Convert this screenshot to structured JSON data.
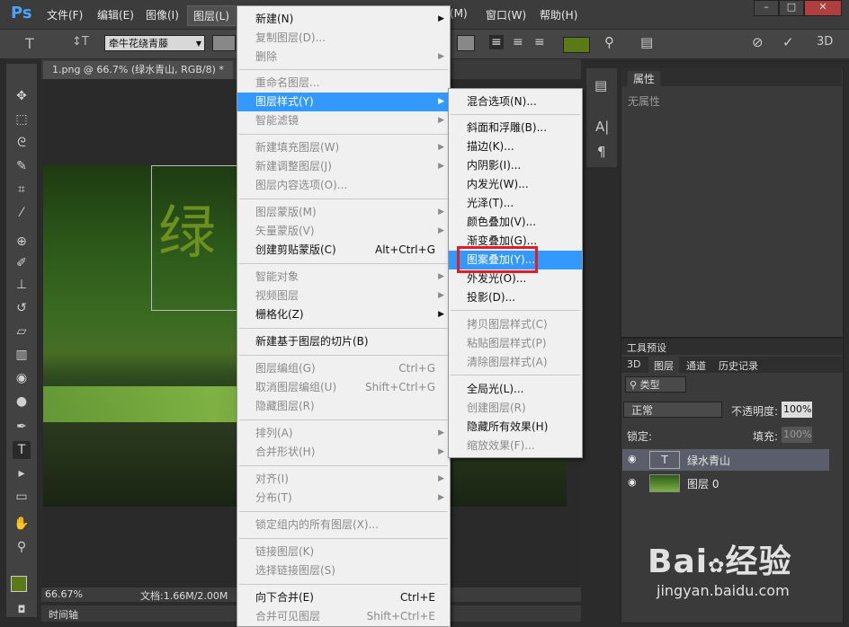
{
  "menubar": {
    "logo": "Ps",
    "items": [
      "文件(F)",
      "编辑(E)",
      "图像(I)",
      "图层(L)",
      "(M)",
      "窗口(W)",
      "帮助(H)"
    ]
  },
  "options": {
    "font_name": "牵牛花绕青藤"
  },
  "document": {
    "tab_title": "1.png @ 66.7% (绿水青山, RGB/8) *",
    "canvas_text": "绿",
    "zoom": "66.67%",
    "doc_size": "文档:1.66M/2.00M",
    "timeline": "时间轴"
  },
  "layer_menu": {
    "items": [
      {
        "label": "新建(N)",
        "shortcut": "",
        "arrow": true,
        "disabled": false
      },
      {
        "label": "复制图层(D)...",
        "shortcut": "",
        "arrow": false,
        "disabled": true
      },
      {
        "label": "删除",
        "shortcut": "",
        "arrow": true,
        "disabled": true
      },
      {
        "label": "重命名图层...",
        "shortcut": "",
        "arrow": false,
        "disabled": true
      },
      {
        "label": "图层样式(Y)",
        "shortcut": "",
        "arrow": true,
        "disabled": false,
        "highlight": true
      },
      {
        "label": "智能滤镜",
        "shortcut": "",
        "arrow": true,
        "disabled": true
      },
      {
        "label": "新建填充图层(W)",
        "shortcut": "",
        "arrow": true,
        "disabled": true
      },
      {
        "label": "新建调整图层(J)",
        "shortcut": "",
        "arrow": true,
        "disabled": true
      },
      {
        "label": "图层内容选项(O)...",
        "shortcut": "",
        "arrow": false,
        "disabled": true
      },
      {
        "label": "图层蒙版(M)",
        "shortcut": "",
        "arrow": true,
        "disabled": true
      },
      {
        "label": "矢量蒙版(V)",
        "shortcut": "",
        "arrow": true,
        "disabled": true
      },
      {
        "label": "创建剪贴蒙版(C)",
        "shortcut": "Alt+Ctrl+G",
        "arrow": false,
        "disabled": false
      },
      {
        "label": "智能对象",
        "shortcut": "",
        "arrow": true,
        "disabled": true
      },
      {
        "label": "视频图层",
        "shortcut": "",
        "arrow": true,
        "disabled": true
      },
      {
        "label": "栅格化(Z)",
        "shortcut": "",
        "arrow": true,
        "disabled": false
      },
      {
        "label": "新建基于图层的切片(B)",
        "shortcut": "",
        "arrow": false,
        "disabled": false
      },
      {
        "label": "图层编组(G)",
        "shortcut": "Ctrl+G",
        "arrow": false,
        "disabled": true
      },
      {
        "label": "取消图层编组(U)",
        "shortcut": "Shift+Ctrl+G",
        "arrow": false,
        "disabled": true
      },
      {
        "label": "隐藏图层(R)",
        "shortcut": "",
        "arrow": false,
        "disabled": true
      },
      {
        "label": "排列(A)",
        "shortcut": "",
        "arrow": true,
        "disabled": true
      },
      {
        "label": "合并形状(H)",
        "shortcut": "",
        "arrow": true,
        "disabled": true
      },
      {
        "label": "对齐(I)",
        "shortcut": "",
        "arrow": true,
        "disabled": true
      },
      {
        "label": "分布(T)",
        "shortcut": "",
        "arrow": true,
        "disabled": true
      },
      {
        "label": "锁定组内的所有图层(X)...",
        "shortcut": "",
        "arrow": false,
        "disabled": true
      },
      {
        "label": "链接图层(K)",
        "shortcut": "",
        "arrow": false,
        "disabled": true
      },
      {
        "label": "选择链接图层(S)",
        "shortcut": "",
        "arrow": false,
        "disabled": true
      },
      {
        "label": "向下合并(E)",
        "shortcut": "Ctrl+E",
        "arrow": false,
        "disabled": false
      },
      {
        "label": "合并可见图层",
        "shortcut": "Shift+Ctrl+E",
        "arrow": false,
        "disabled": true
      }
    ]
  },
  "style_submenu": {
    "items": [
      {
        "label": "混合选项(N)...",
        "disabled": false
      },
      {
        "label": "斜面和浮雕(B)...",
        "disabled": false
      },
      {
        "label": "描边(K)...",
        "disabled": false
      },
      {
        "label": "内阴影(I)...",
        "disabled": false
      },
      {
        "label": "内发光(W)...",
        "disabled": false
      },
      {
        "label": "光泽(T)...",
        "disabled": false
      },
      {
        "label": "颜色叠加(V)...",
        "disabled": false
      },
      {
        "label": "渐变叠加(G)...",
        "disabled": false
      },
      {
        "label": "图案叠加(Y)...",
        "disabled": false,
        "highlight": true
      },
      {
        "label": "外发光(O)...",
        "disabled": false
      },
      {
        "label": "投影(D)...",
        "disabled": false
      },
      {
        "label": "拷贝图层样式(C)",
        "disabled": true
      },
      {
        "label": "粘贴图层样式(P)",
        "disabled": true
      },
      {
        "label": "清除图层样式(A)",
        "disabled": true
      },
      {
        "label": "全局光(L)...",
        "disabled": false
      },
      {
        "label": "创建图层(R)",
        "disabled": true
      },
      {
        "label": "隐藏所有效果(H)",
        "disabled": false
      },
      {
        "label": "缩放效果(F)...",
        "disabled": true
      }
    ]
  },
  "properties_panel": {
    "title": "属性",
    "empty_text": "无属性"
  },
  "layers_panel": {
    "top_tab": "工具预设",
    "tabs": [
      "3D",
      "图层",
      "通道",
      "历史记录"
    ],
    "filter_label": "类型",
    "blend_mode": "正常",
    "opacity_label": "不透明度:",
    "opacity_value": "100%",
    "lock_label": "锁定:",
    "fill_label": "填充:",
    "fill_value": "100%",
    "layers": [
      {
        "name": "绿水青山",
        "thumb": "T"
      },
      {
        "name": "图层 0",
        "thumb": ""
      }
    ]
  },
  "watermark": {
    "brand_text": "Bai",
    "brand_text2": "经验",
    "url": "jingyan.baidu.com"
  },
  "colors": {
    "highlight": "#3399ff",
    "red_box": "#e41e1e",
    "foreground": "#5b7a16"
  }
}
